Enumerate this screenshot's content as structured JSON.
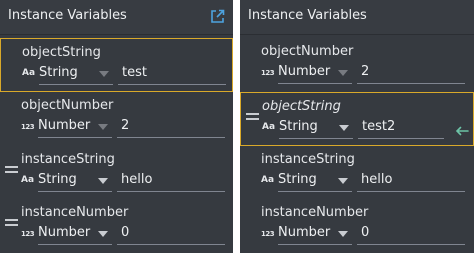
{
  "panels": [
    {
      "title": "Instance Variables",
      "rows": [
        {
          "name": "objectString",
          "type": "String",
          "value": "test"
        },
        {
          "name": "objectNumber",
          "type": "Number",
          "value": "2"
        },
        {
          "name": "instanceString",
          "type": "String",
          "value": "hello"
        },
        {
          "name": "instanceNumber",
          "type": "Number",
          "value": "0"
        }
      ]
    },
    {
      "title": "Instance Variables",
      "rows": [
        {
          "name": "objectNumber",
          "type": "Number",
          "value": "2"
        },
        {
          "name": "objectString",
          "type": "String",
          "value": "test2"
        },
        {
          "name": "instanceString",
          "type": "String",
          "value": "hello"
        },
        {
          "name": "instanceNumber",
          "type": "Number",
          "value": "0"
        }
      ]
    }
  ],
  "type_icons": {
    "string": "Aa",
    "number": "123"
  },
  "colors": {
    "panel_bg": "#363a40",
    "selection_border": "#d9a92a",
    "revert_icon": "#6cc3a6"
  }
}
